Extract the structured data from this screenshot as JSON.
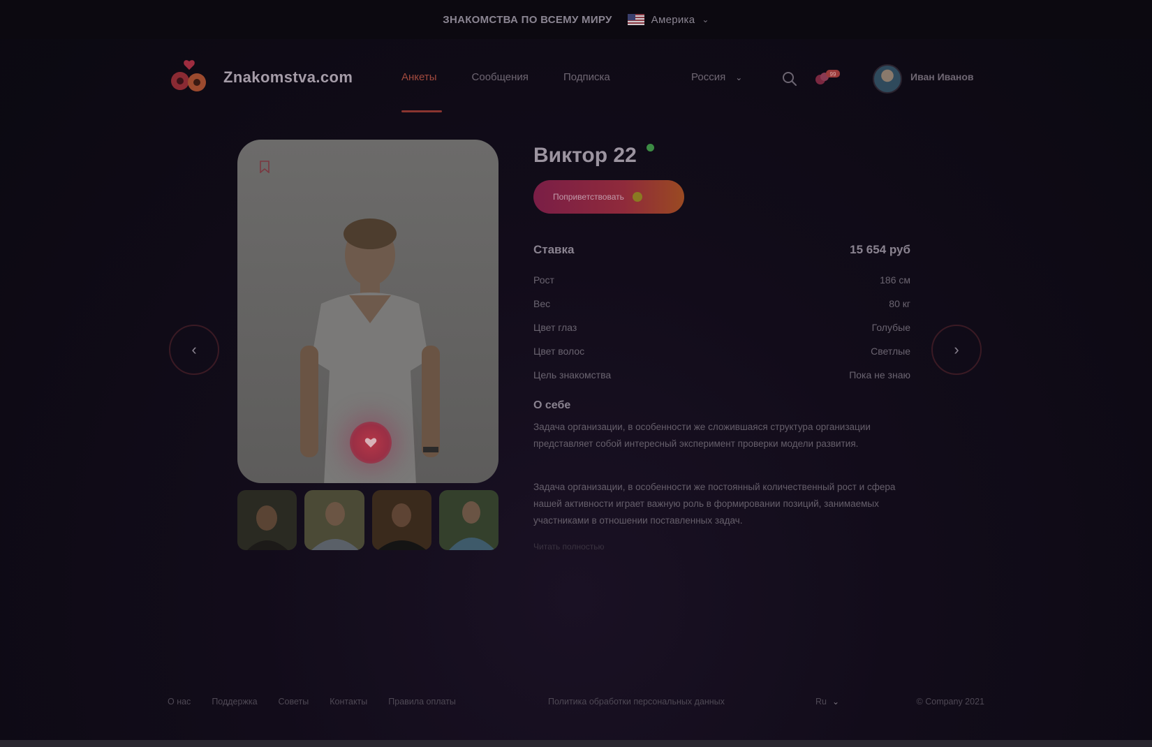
{
  "topbar": {
    "slogan": "ЗНАКОМСТВА ПО ВСЕМУ МИРУ",
    "country": "Америка"
  },
  "header": {
    "brand": "Znakomstva.com",
    "nav": [
      {
        "label": "Анкеты",
        "active": true
      },
      {
        "label": "Сообщения",
        "active": false
      },
      {
        "label": "Подписка",
        "active": false
      }
    ],
    "region": "Россия",
    "notifications_badge": "99",
    "user_name": "Иван Иванов"
  },
  "profile": {
    "name": "Виктор 22",
    "online": true,
    "cta_label": "Поприветствовать",
    "rate": {
      "label": "Ставка",
      "value": "15 654 руб"
    },
    "stats": [
      {
        "label": "Рост",
        "value": "186 см"
      },
      {
        "label": "Вес",
        "value": "80 кг"
      },
      {
        "label": "Цвет глаз",
        "value": "Голубые"
      },
      {
        "label": "Цвет волос",
        "value": "Светлые"
      },
      {
        "label": "Цель знакомства",
        "value": "Пока не знаю"
      }
    ],
    "about_title": "О себе",
    "about_p1": "Задача организации, в особенности же сложившаяся структура организации представляет собой интересный эксперимент проверки модели развития.",
    "about_p2": "Задача организации, в особенности же постоянный количественный рост и сфера нашей активности играет важную роль в формировании позиций, занимаемых участниками в отношении поставленных задач.",
    "more_link": "Читать полностью"
  },
  "footer": {
    "links": [
      "О нас",
      "Поддержка",
      "Советы",
      "Контакты",
      "Правила оплаты"
    ],
    "policy": "Политика обработки персональных данных",
    "lang": "Ru",
    "copyright": "© Company 2021"
  },
  "colors": {
    "accent": "#a24a3e",
    "online": "#3c8b44",
    "cta_start": "#7a1e46",
    "cta_end": "#9a4a22"
  }
}
